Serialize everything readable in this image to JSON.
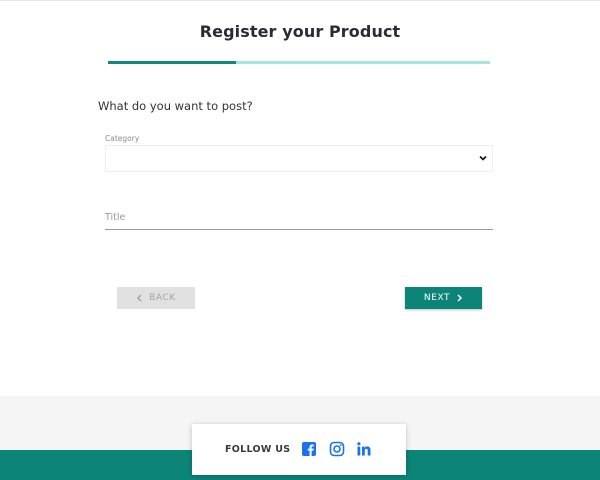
{
  "page": {
    "title": "Register your Product",
    "progress_fraction": 0.336
  },
  "form": {
    "question": "What do you want to post?",
    "category_label": "Category",
    "category_value": "",
    "title_placeholder": "Title",
    "title_value": ""
  },
  "buttons": {
    "back_label": "BACK",
    "next_label": "NEXT"
  },
  "footer": {
    "follow_label": "FOLLOW US",
    "social_icons": [
      "facebook-icon",
      "instagram-icon",
      "linkedin-icon"
    ]
  },
  "colors": {
    "accent": "#0c8478",
    "progress_track": "#a6e4e0",
    "social_blue": "#1a73e8",
    "back_button_bg": "#e1e1e1"
  }
}
